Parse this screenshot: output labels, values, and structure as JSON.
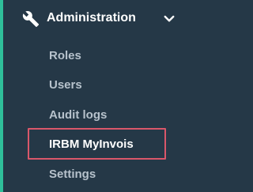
{
  "sidebar": {
    "section": {
      "title": "Administration",
      "icon": "wrench-icon",
      "toggle_icon": "chevron-down-icon",
      "expanded": true
    },
    "items": [
      {
        "label": "Roles",
        "active": false
      },
      {
        "label": "Users",
        "active": false
      },
      {
        "label": "Audit logs",
        "active": false
      },
      {
        "label": "IRBM MyInvois",
        "active": true
      },
      {
        "label": "Settings",
        "active": false
      }
    ]
  },
  "colors": {
    "background": "#253847",
    "accent": "#2fbf9a",
    "item_text": "#b7c2cc",
    "active_text": "#ffffff",
    "highlight_border": "#d9576a"
  }
}
